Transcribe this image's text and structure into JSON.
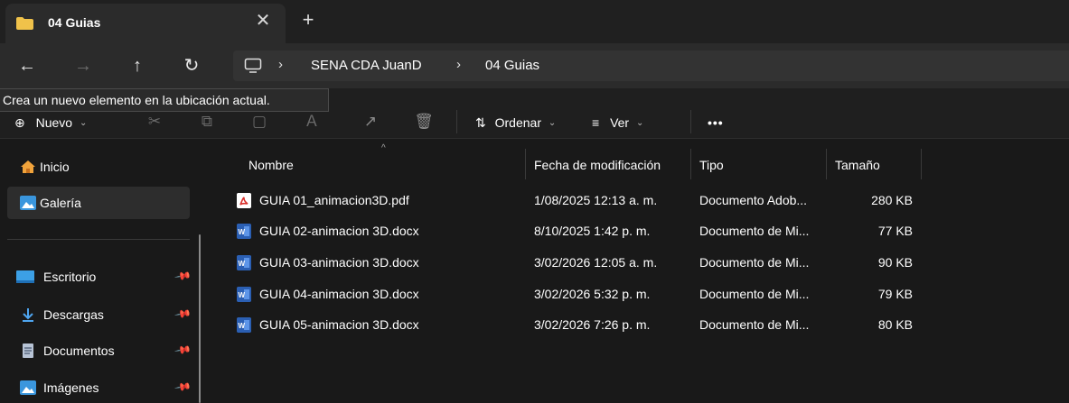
{
  "tab": {
    "title": "04 Guias",
    "close_glyph": "✕",
    "new_tab_glyph": "+"
  },
  "nav": {
    "back_glyph": "←",
    "forward_glyph": "→",
    "up_glyph": "↑",
    "refresh_glyph": "↻",
    "breadcrumb": [
      "SENA CDA JuanD",
      "04 Guias"
    ],
    "separator_glyph": "›"
  },
  "tooltip": {
    "text": "Crea un nuevo elemento en la ubicación actual."
  },
  "toolbar": {
    "new_label": "Nuevo",
    "new_glyph": "⊕",
    "sort_label": "Ordenar",
    "sort_glyph": "⇅",
    "view_label": "Ver",
    "view_glyph": "≡",
    "more_glyph": "•••",
    "chevron_glyph": "⌄",
    "cut_glyph": "✂",
    "copy_glyph": "⧉",
    "paste_glyph": "▢",
    "rename_glyph": "Ａ",
    "share_glyph": "↗",
    "delete_glyph": "🗑"
  },
  "sidebar": {
    "pin_glyph": "📌",
    "items": [
      {
        "label": "Inicio",
        "icon": "home-icon"
      },
      {
        "label": "Galería",
        "icon": "gallery-icon",
        "selected": true
      },
      {
        "label": "Escritorio",
        "icon": "desktop-icon",
        "pinned": true
      },
      {
        "label": "Descargas",
        "icon": "download-icon",
        "pinned": true
      },
      {
        "label": "Documentos",
        "icon": "documents-icon",
        "pinned": true
      },
      {
        "label": "Imágenes",
        "icon": "pictures-icon",
        "pinned": true
      }
    ]
  },
  "columns": {
    "name": "Nombre",
    "modified": "Fecha de modificación",
    "type": "Tipo",
    "size": "Tamaño",
    "sort_glyph": "^"
  },
  "files": [
    {
      "name": "GUIA 01_animacion3D.pdf",
      "modified": "1/08/2025 12:13 a. m.",
      "type": "Documento Adob...",
      "size": "280 KB",
      "icon": "pdf-icon"
    },
    {
      "name": "GUIA 02-animacion 3D.docx",
      "modified": "8/10/2025 1:42 p. m.",
      "type": "Documento de Mi...",
      "size": "77 KB",
      "icon": "word-icon"
    },
    {
      "name": "GUIA 03-animacion 3D.docx",
      "modified": "3/02/2026 12:05 a. m.",
      "type": "Documento de Mi...",
      "size": "90 KB",
      "icon": "word-icon"
    },
    {
      "name": "GUIA 04-animacion 3D.docx",
      "modified": "3/02/2026 5:32 p. m.",
      "type": "Documento de Mi...",
      "size": "79 KB",
      "icon": "word-icon"
    },
    {
      "name": "GUIA 05-animacion 3D.docx",
      "modified": "3/02/2026 7:26 p. m.",
      "type": "Documento de Mi...",
      "size": "80 KB",
      "icon": "word-icon"
    }
  ],
  "colors": {
    "accent_folder": "#f0c24a",
    "word_blue": "#2b5fb3",
    "pdf_red": "#d9302c",
    "background": "#191919"
  }
}
